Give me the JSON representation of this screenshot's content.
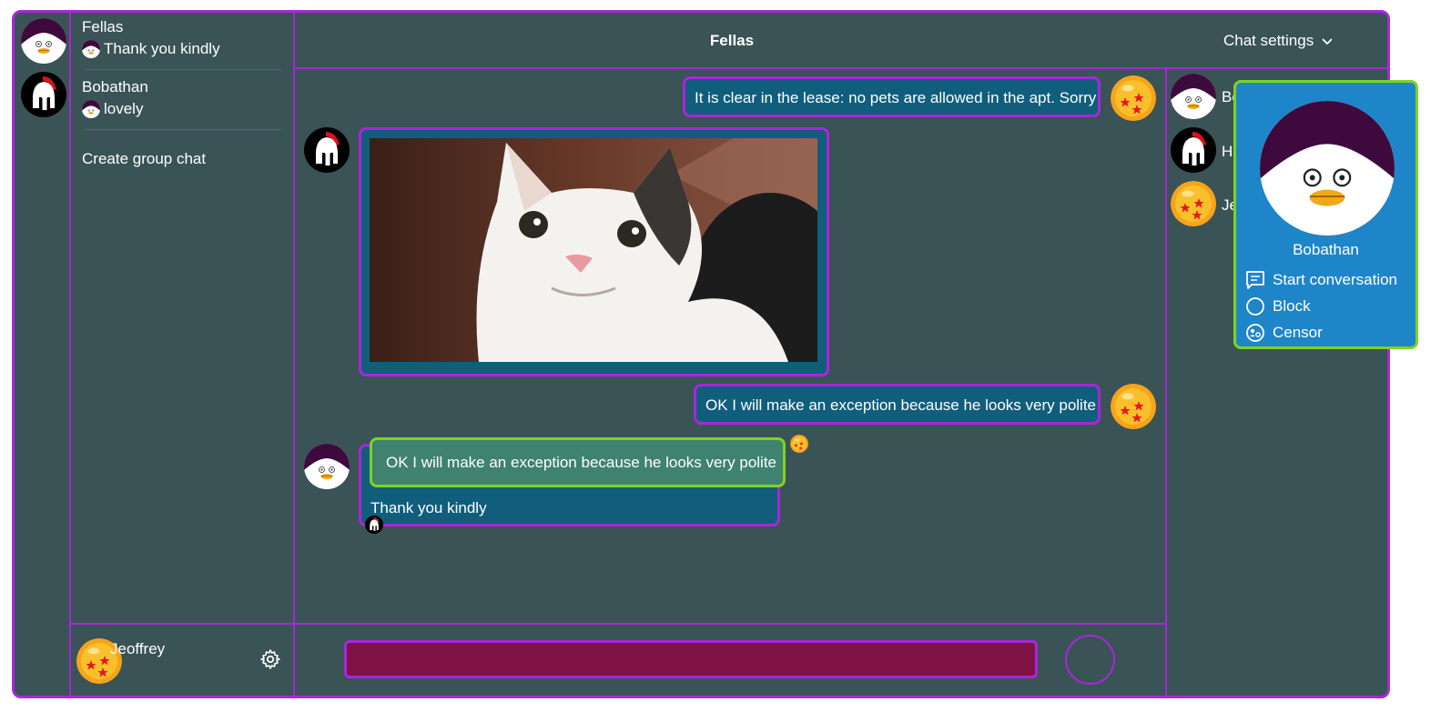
{
  "conversations": [
    {
      "name": "Fellas",
      "last_message": "Thank you kindly"
    },
    {
      "name": "Bobathan",
      "last_message": "lovely"
    }
  ],
  "create_group": "Create group chat",
  "header": {
    "title": "Fellas",
    "settings_label": "Chat settings"
  },
  "messages": {
    "m1": "It is clear in the lease: no pets are allowed in the apt. Sorry",
    "m3": "OK I will make an exception because he looks very polite",
    "m4_quote": "OK I will make an exception because he looks very polite",
    "m4_text": "Thank you kindly"
  },
  "members": [
    {
      "name_visible": "Bo"
    },
    {
      "name_visible": "Hi"
    },
    {
      "name_visible": "Je"
    }
  ],
  "popup": {
    "name": "Bobathan",
    "actions": [
      "Start conversation",
      "Block",
      "Censor"
    ]
  },
  "current_user": {
    "name": "Jeoffrey"
  },
  "composer": {
    "value": ""
  },
  "colors": {
    "background": "#3a5357",
    "border": "#a927d9",
    "bubble": "#105e7c",
    "quote": "#3f8270",
    "quote_border": "#7ed321",
    "popup": "#1f85c9",
    "input": "#801345"
  },
  "icons": [
    "gear-icon",
    "chevron-down-icon",
    "chat-icon",
    "circle-icon",
    "face-icon"
  ]
}
